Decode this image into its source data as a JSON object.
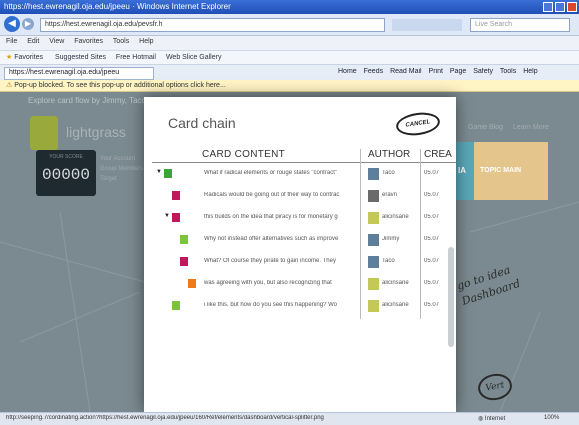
{
  "window": {
    "title": "https://hest.ewrenagil.oja.edu/jpeeu · Windows Internet Explorer",
    "address": "https://hest.ewrenagil.oja.edu/pevsfr.h",
    "search_placeholder": "Live Search",
    "menus": [
      "File",
      "Edit",
      "View",
      "Favorites",
      "Tools",
      "Help"
    ],
    "favorites_label": "Favorites",
    "fav_links": [
      "Suggested Sites",
      "Free Hotmail",
      "Web Slice Gallery"
    ],
    "tab_title": "https://hest.ewrenagil.oja.edu/jpeeu",
    "toolbar_right": [
      "Home",
      "Feeds",
      "Read Mail",
      "Print",
      "Page",
      "Safety",
      "Tools",
      "Help"
    ],
    "infobar": "Pop-up blocked. To see this pop-up or additional options click here...",
    "status_text": "http://seeping.7/cordinating.action?https://hest.ewrenagil.oja.edu/jpeeu/160/Ref/elements/dashboard/vertical-splitter.png",
    "status_zone": "Internet",
    "status_zoom": "100%"
  },
  "app": {
    "subtitle": "Explore card flow by Jimmy, Taco and",
    "name": "lightgrass",
    "score_label": "YOUR SCORE",
    "score": "00000",
    "side_links": [
      "Your Account",
      "Group Members",
      "Target"
    ],
    "right_links": [
      "Game Blog",
      "Learn More"
    ],
    "right_tabs": [
      "IA",
      "TOPIC MAIN"
    ]
  },
  "modal": {
    "title": "Card chain",
    "logo_text": "CANCEL",
    "columns": {
      "content": "CARD CONTENT",
      "author": "AUTHOR",
      "created": "CREA"
    },
    "rows": [
      {
        "marker": "▼",
        "color": "#3aa53a",
        "indent": 0,
        "content": "What if radical elements or rouge states \"contract\"",
        "author": "Taco",
        "created": "05.07"
      },
      {
        "marker": "",
        "color": "#c0185a",
        "indent": 1,
        "content": "Radicals would be going out of their way to contrac",
        "author": "eravn",
        "created": "05.07"
      },
      {
        "marker": "▼",
        "color": "#c0185a",
        "indent": 1,
        "content": "this builds on the idea that piracy is for monetary g",
        "author": "alicinsane",
        "created": "05.07"
      },
      {
        "marker": "",
        "color": "#7ac43a",
        "indent": 2,
        "content": "Why not instead offer alternatives such as improve",
        "author": "Jimmy",
        "created": "05.07"
      },
      {
        "marker": "",
        "color": "#c0185a",
        "indent": 2,
        "content": "What? Of course they pirate to gain income. They",
        "author": "Taco",
        "created": "05.07"
      },
      {
        "marker": "",
        "color": "#f07a1a",
        "indent": 3,
        "content": "was agreeing with you, but also recognizing that",
        "author": "alicinsane",
        "created": "05.07"
      },
      {
        "marker": "",
        "color": "#7ac43a",
        "indent": 2,
        "content": "i like this, but how do you see this happening? Wo",
        "author": "alicinsane",
        "created": "05.07"
      }
    ]
  },
  "sketch": {
    "line1": "go to idea",
    "line2": "Dashboard",
    "bottom": "Vert"
  },
  "colors": {
    "accent_blue": "#1f4fb6",
    "card_green": "#3aa53a",
    "card_red": "#c0185a",
    "card_orange": "#f07a1a",
    "card_lightgreen": "#7ac43a",
    "right_tab_teal": "#58a7b8",
    "right_tab_tan": "#e4c68c"
  }
}
